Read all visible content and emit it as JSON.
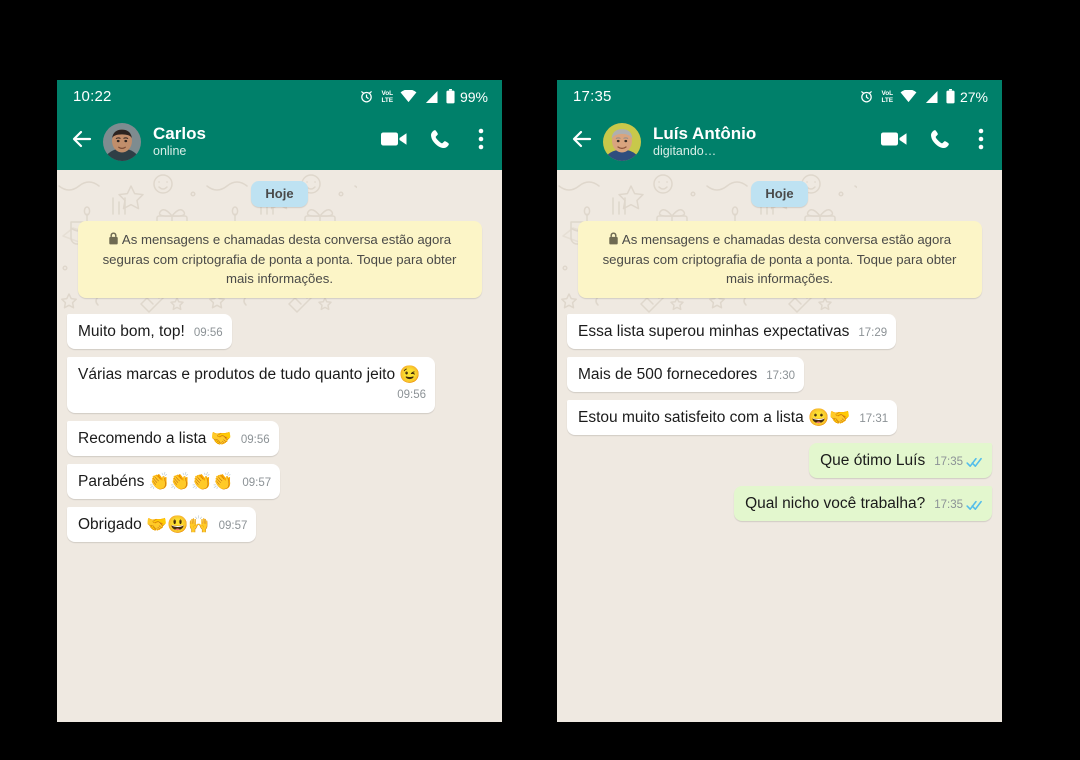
{
  "colors": {
    "header_green": "#00806A",
    "chat_background": "#EFE9E1",
    "incoming_bubble": "#FFFFFF",
    "outgoing_bubble": "#E3F7CE",
    "date_pill": "#BEE2F2",
    "encryption_notice": "#FCF5C7",
    "read_tick_blue": "#53BDEB",
    "page_background": "#000000"
  },
  "panels": [
    {
      "id": "carlos",
      "statusbar": {
        "time": "10:22",
        "battery_percent": "99%",
        "network_label_top": "VoLTE",
        "network_label_line1": "VoL",
        "network_label_line2": "LTE",
        "icons": [
          "alarm-icon",
          "volte-icon",
          "wifi-icon",
          "signal-icon",
          "battery-icon"
        ]
      },
      "appbar": {
        "back_icon": "back-arrow-icon",
        "avatar_name": "avatar",
        "peer_name": "Carlos",
        "peer_status": "online",
        "actions": [
          {
            "name": "video-call-button",
            "icon": "video-camera-icon"
          },
          {
            "name": "voice-call-button",
            "icon": "phone-icon"
          },
          {
            "name": "overflow-menu-button",
            "icon": "three-dots-vertical-icon"
          }
        ]
      },
      "chat": {
        "date_divider": "Hoje",
        "encryption_notice": "As mensagens e chamadas desta conversa estão agora seguras com criptografia de ponta a ponta. Toque para obter mais informações.",
        "messages": [
          {
            "direction": "in",
            "text": "Muito bom, top!",
            "emoji": "",
            "time": "09:56",
            "status": "",
            "wrap_meta": false
          },
          {
            "direction": "in",
            "text": "Várias marcas e produtos de tudo quanto jeito ",
            "emoji": "😉",
            "time": "09:56",
            "status": "",
            "wrap_meta": true
          },
          {
            "direction": "in",
            "text": "Recomendo a lista ",
            "emoji": "🤝",
            "time": "09:56",
            "status": "",
            "wrap_meta": false
          },
          {
            "direction": "in",
            "text": "Parabéns ",
            "emoji": "👏👏👏👏",
            "time": "09:57",
            "status": "",
            "wrap_meta": false
          },
          {
            "direction": "in",
            "text": "Obrigado ",
            "emoji": "🤝😃🙌",
            "time": "09:57",
            "status": "",
            "wrap_meta": false
          }
        ]
      }
    },
    {
      "id": "luis-antonio",
      "statusbar": {
        "time": "17:35",
        "battery_percent": "27%",
        "network_label_top": "VoLTE",
        "network_label_line1": "VoL",
        "network_label_line2": "LTE",
        "icons": [
          "alarm-icon",
          "volte-icon",
          "wifi-icon",
          "signal-icon",
          "battery-icon"
        ]
      },
      "appbar": {
        "back_icon": "back-arrow-icon",
        "avatar_name": "avatar",
        "peer_name": "Luís Antônio",
        "peer_status": "digitando…",
        "actions": [
          {
            "name": "video-call-button",
            "icon": "video-camera-icon"
          },
          {
            "name": "voice-call-button",
            "icon": "phone-icon"
          },
          {
            "name": "overflow-menu-button",
            "icon": "three-dots-vertical-icon"
          }
        ]
      },
      "chat": {
        "date_divider": "Hoje",
        "encryption_notice": "As mensagens e chamadas desta conversa estão agora seguras com criptografia de ponta a ponta. Toque para obter mais informações.",
        "messages": [
          {
            "direction": "in",
            "text": "Essa lista superou minhas expectativas",
            "emoji": "",
            "time": "17:29",
            "status": "",
            "wrap_meta": false
          },
          {
            "direction": "in",
            "text": "Mais de 500 fornecedores",
            "emoji": "",
            "time": "17:30",
            "status": "",
            "wrap_meta": false
          },
          {
            "direction": "in",
            "text": "Estou muito satisfeito com a lista ",
            "emoji": "😀🤝",
            "time": "17:31",
            "status": "",
            "wrap_meta": false
          },
          {
            "direction": "out",
            "text": "Que ótimo Luís",
            "emoji": "",
            "time": "17:35",
            "status": "read",
            "wrap_meta": false
          },
          {
            "direction": "out",
            "text": "Qual nicho você trabalha?",
            "emoji": "",
            "time": "17:35",
            "status": "read",
            "wrap_meta": false
          }
        ]
      }
    }
  ]
}
